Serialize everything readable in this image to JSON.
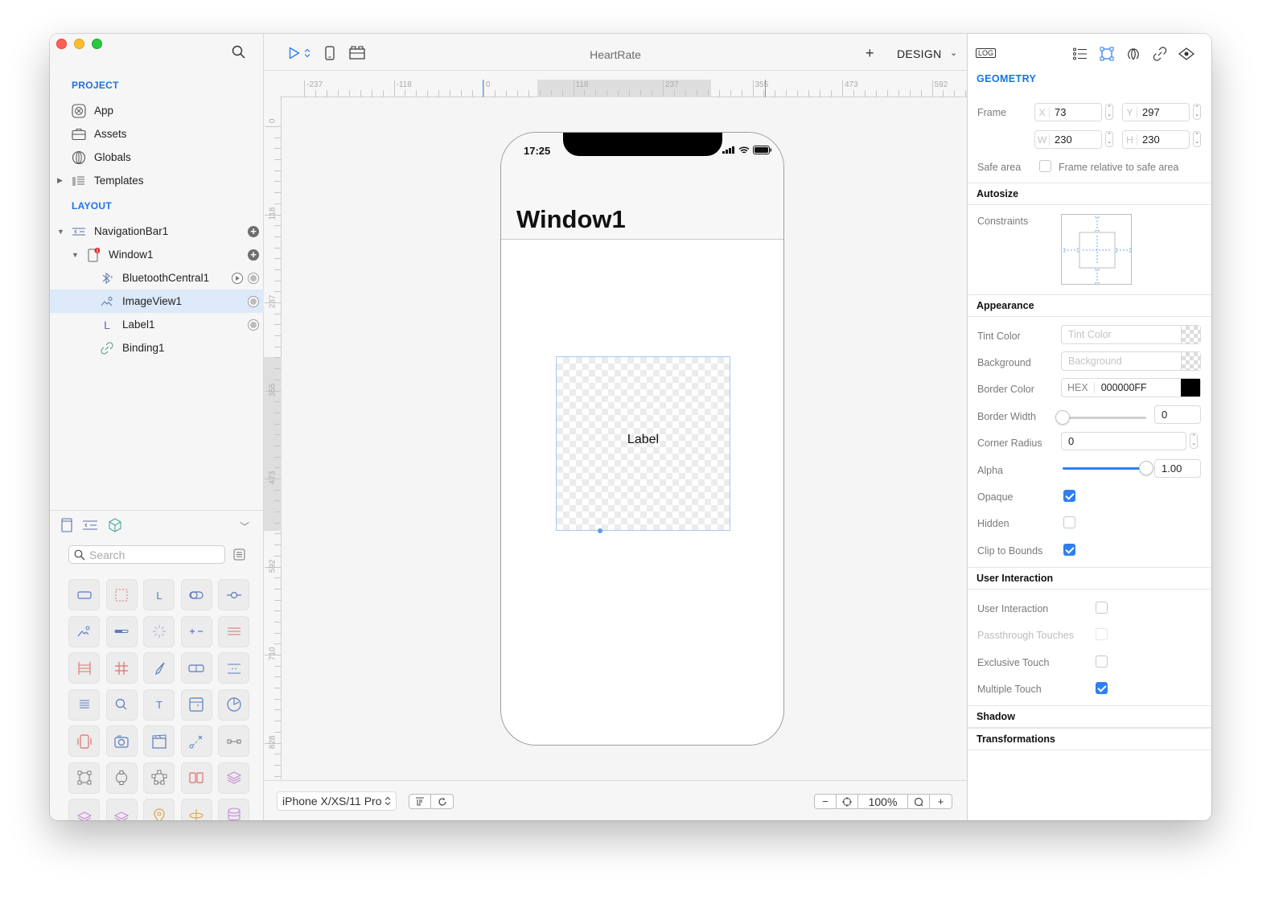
{
  "window": {
    "title": "HeartRate"
  },
  "sidebar": {
    "project_heading": "PROJECT",
    "project_items": [
      {
        "label": "App",
        "icon": "app-icon"
      },
      {
        "label": "Assets",
        "icon": "briefcase-icon"
      },
      {
        "label": "Globals",
        "icon": "globe-icon"
      },
      {
        "label": "Templates",
        "icon": "templates-icon"
      }
    ],
    "layout_heading": "LAYOUT",
    "layout_items": [
      {
        "label": "NavigationBar1",
        "icon": "navigation-bar-icon",
        "badge": ""
      },
      {
        "label": "Window1",
        "icon": "window-icon",
        "badge": "1"
      },
      {
        "label": "BluetoothCentral1",
        "icon": "bluetooth-icon"
      },
      {
        "label": "ImageView1",
        "icon": "image-icon",
        "selected": true
      },
      {
        "label": "Label1",
        "icon": "label-icon"
      },
      {
        "label": "Binding1",
        "icon": "link-icon"
      }
    ],
    "library": {
      "search_placeholder": "Search",
      "tabs": [
        "window-tab",
        "navigation-tab",
        "objects-tab"
      ],
      "items": [
        "button",
        "view",
        "label",
        "switch",
        "slider",
        "image-view",
        "progress-view",
        "activity-indicator",
        "stepper",
        "segmented-separator",
        "table-view",
        "grid-view",
        "compass",
        "segmented-control",
        "page-control",
        "text-view",
        "search-bar",
        "text-field",
        "date-picker",
        "clock",
        "vibration",
        "camera",
        "media-player",
        "path-gesture",
        "connector",
        "rectangle-shape",
        "circle-shape",
        "polygon-shape",
        "columns",
        "layers",
        "layers-2",
        "layers-3",
        "location-pin",
        "level",
        "database"
      ]
    }
  },
  "toolbar": {
    "run_icon": "play-icon",
    "title": "HeartRate",
    "add_label": "+",
    "mode_label": "DESIGN"
  },
  "rulers": {
    "horizontal_labels": [
      "-237",
      "-118",
      "0",
      "118",
      "237",
      "355",
      "473",
      "592"
    ],
    "vertical_labels": [
      "0",
      "118",
      "237",
      "355",
      "473",
      "592",
      "710",
      "828"
    ]
  },
  "phone": {
    "status_time": "17:25",
    "nav_title": "Window1",
    "image_label": "Label"
  },
  "bottombar": {
    "device": "iPhone X/XS/11 Pro",
    "zoom": "100%",
    "zoom_out": "−",
    "zoom_in": "+"
  },
  "inspector": {
    "log_label": "LOG",
    "geometry_heading": "GEOMETRY",
    "frame_label": "Frame",
    "frame": {
      "x_prefix": "X",
      "x": "73",
      "y_prefix": "Y",
      "y": "297",
      "w_prefix": "W",
      "w": "230",
      "h_prefix": "H",
      "h": "230"
    },
    "safe_area_label": "Safe area",
    "safe_area_checkbox_label": "Frame relative to safe area",
    "safe_area_checked": false,
    "autosize_heading": "Autosize",
    "constraints_label": "Constraints",
    "appearance_heading": "Appearance",
    "tint_color_label": "Tint Color",
    "tint_color_placeholder": "Tint Color",
    "background_label": "Background",
    "background_placeholder": "Background",
    "border_color_label": "Border Color",
    "border_color_prefix": "HEX",
    "border_color_value": "000000FF",
    "border_color_swatch": "#000000",
    "border_width_label": "Border Width",
    "border_width_value": "0",
    "border_width_fraction": 0,
    "corner_radius_label": "Corner Radius",
    "corner_radius_value": "0",
    "alpha_label": "Alpha",
    "alpha_value": "1.00",
    "alpha_fraction": 1.0,
    "opaque_label": "Opaque",
    "opaque_checked": true,
    "hidden_label": "Hidden",
    "hidden_checked": false,
    "clip_label": "Clip to Bounds",
    "clip_checked": true,
    "user_interaction_heading": "User Interaction",
    "user_interaction_label": "User Interaction",
    "user_interaction_checked": false,
    "passthrough_label": "Passthrough Touches",
    "passthrough_checked": false,
    "exclusive_label": "Exclusive Touch",
    "exclusive_checked": false,
    "multiple_label": "Multiple Touch",
    "multiple_checked": true,
    "shadow_heading": "Shadow",
    "transformations_heading": "Transformations"
  },
  "colors": {
    "accent": "#1a73e8",
    "checkbox": "#2f7ef0",
    "selection": "#dce9f8",
    "badge": "#e0262b"
  }
}
